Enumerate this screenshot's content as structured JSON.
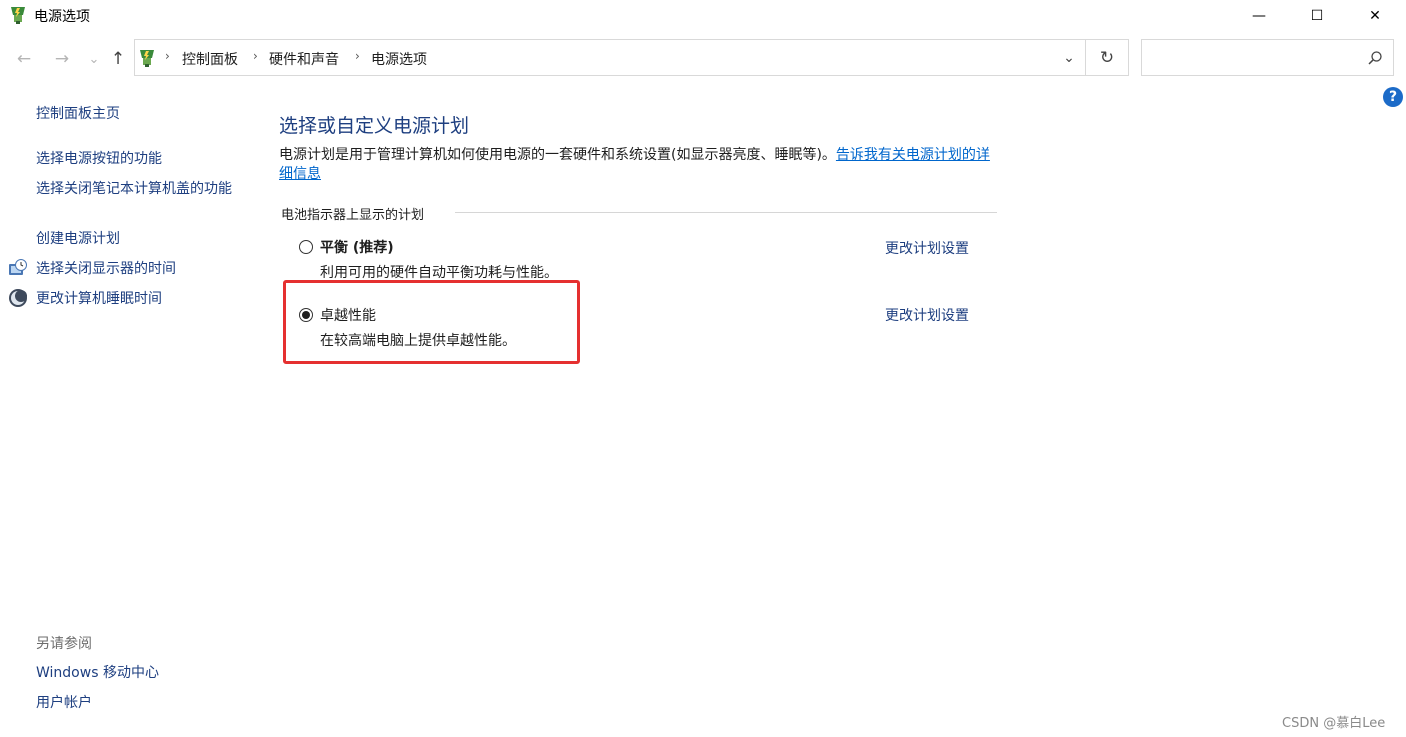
{
  "window": {
    "title": "电源选项",
    "minimize_glyph": "—",
    "maximize_glyph": "☐",
    "close_glyph": "✕"
  },
  "nav": {
    "back_glyph": "←",
    "forward_glyph": "→",
    "recent_glyph": "⌄",
    "up_glyph": "↑",
    "breadcrumbs": [
      "控制面板",
      "硬件和声音",
      "电源选项"
    ],
    "separator": "›",
    "dropdown_glyph": "⌄",
    "refresh_glyph": "↻",
    "search_placeholder": ""
  },
  "help": {
    "label": "?"
  },
  "sidebar": {
    "home_label": "控制面板主页",
    "links": [
      "选择电源按钮的功能",
      "选择关闭笔记本计算机盖的功能",
      "创建电源计划",
      "选择关闭显示器的时间",
      "更改计算机睡眠时间"
    ],
    "see_also_label": "另请参阅",
    "see_also_links": [
      "Windows 移动中心",
      "用户帐户"
    ]
  },
  "main": {
    "heading": "选择或自定义电源计划",
    "description": "电源计划是用于管理计算机如何使用电源的一套硬件和系统设置(如显示器亮度、睡眠等)。",
    "learn_more_link": "告诉我有关电源计划的详细信息",
    "group_label": "电池指示器上显示的计划",
    "plans": [
      {
        "name": "平衡 (推荐)",
        "description": "利用可用的硬件自动平衡功耗与性能。",
        "selected": false,
        "change_label": "更改计划设置"
      },
      {
        "name": "卓越性能",
        "description": "在较高端电脑上提供卓越性能。",
        "selected": true,
        "change_label": "更改计划设置"
      }
    ]
  },
  "watermark": "CSDN @慕白Lee",
  "colors": {
    "link": "#1e3f80",
    "highlight_border": "#e53030",
    "help_icon_bg": "#1c6bc8"
  }
}
